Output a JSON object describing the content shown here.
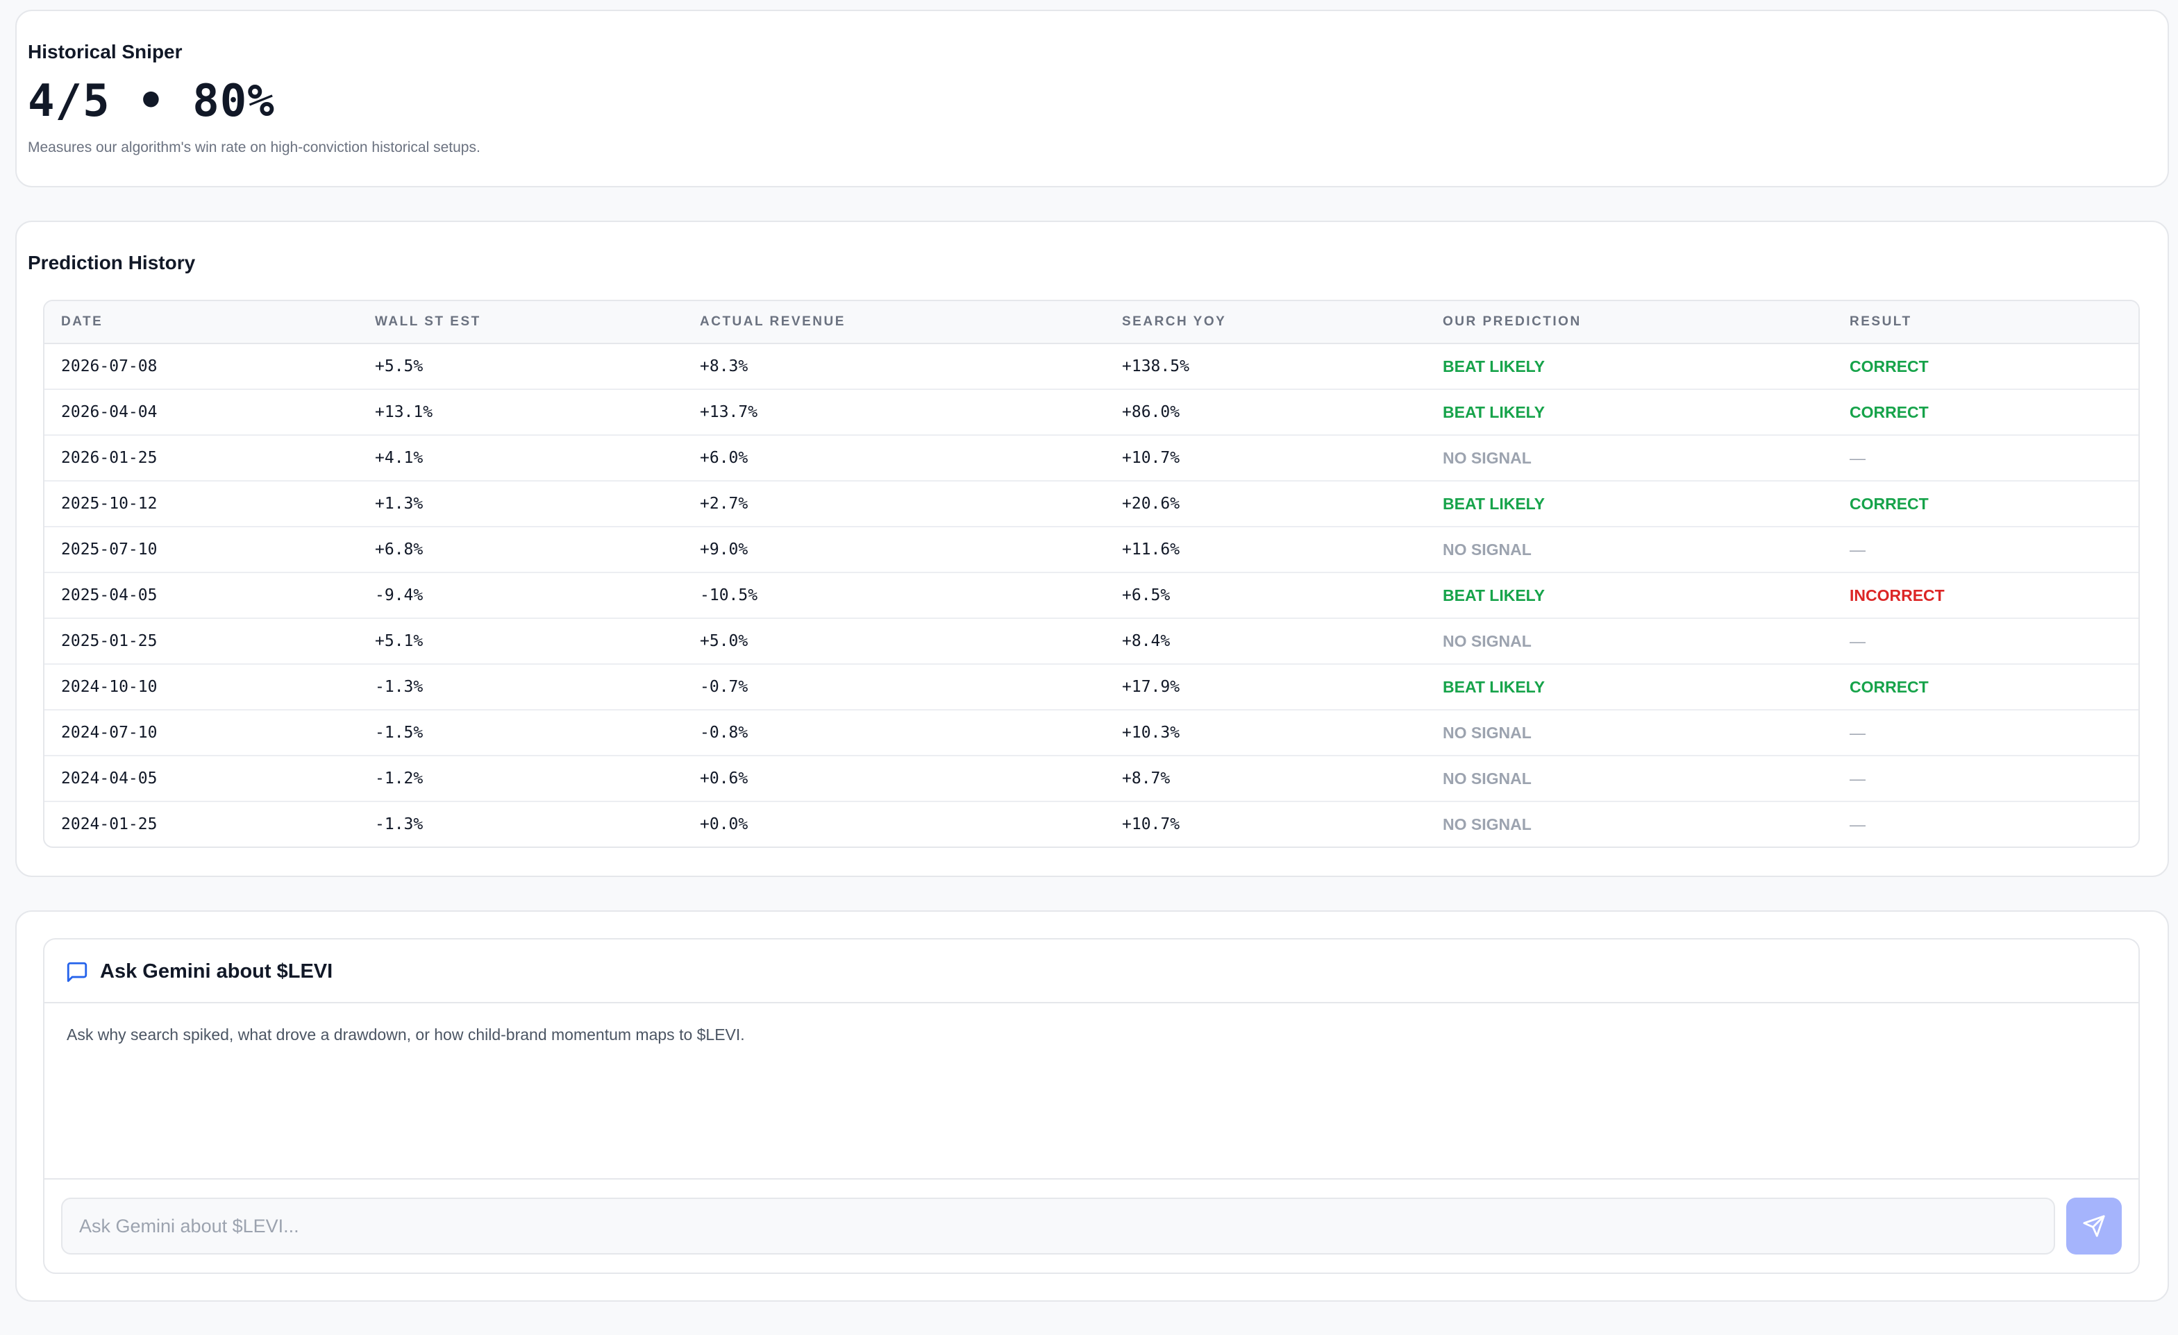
{
  "sniper": {
    "title": "Historical Sniper",
    "score": "4/5 • 80%",
    "description": "Measures our algorithm's win rate on high-conviction historical setups."
  },
  "history": {
    "title": "Prediction History",
    "columns": [
      "DATE",
      "WALL ST EST",
      "ACTUAL REVENUE",
      "SEARCH YOY",
      "OUR PREDICTION",
      "RESULT"
    ],
    "rows": [
      {
        "date": "2026-07-08",
        "wall_st_est": "+5.5%",
        "actual_revenue": "+8.3%",
        "search_yoy": "+138.5%",
        "prediction": "BEAT LIKELY",
        "result": "CORRECT"
      },
      {
        "date": "2026-04-04",
        "wall_st_est": "+13.1%",
        "actual_revenue": "+13.7%",
        "search_yoy": "+86.0%",
        "prediction": "BEAT LIKELY",
        "result": "CORRECT"
      },
      {
        "date": "2026-01-25",
        "wall_st_est": "+4.1%",
        "actual_revenue": "+6.0%",
        "search_yoy": "+10.7%",
        "prediction": "NO SIGNAL",
        "result": "—"
      },
      {
        "date": "2025-10-12",
        "wall_st_est": "+1.3%",
        "actual_revenue": "+2.7%",
        "search_yoy": "+20.6%",
        "prediction": "BEAT LIKELY",
        "result": "CORRECT"
      },
      {
        "date": "2025-07-10",
        "wall_st_est": "+6.8%",
        "actual_revenue": "+9.0%",
        "search_yoy": "+11.6%",
        "prediction": "NO SIGNAL",
        "result": "—"
      },
      {
        "date": "2025-04-05",
        "wall_st_est": "-9.4%",
        "actual_revenue": "-10.5%",
        "search_yoy": "+6.5%",
        "prediction": "BEAT LIKELY",
        "result": "INCORRECT"
      },
      {
        "date": "2025-01-25",
        "wall_st_est": "+5.1%",
        "actual_revenue": "+5.0%",
        "search_yoy": "+8.4%",
        "prediction": "NO SIGNAL",
        "result": "—"
      },
      {
        "date": "2024-10-10",
        "wall_st_est": "-1.3%",
        "actual_revenue": "-0.7%",
        "search_yoy": "+17.9%",
        "prediction": "BEAT LIKELY",
        "result": "CORRECT"
      },
      {
        "date": "2024-07-10",
        "wall_st_est": "-1.5%",
        "actual_revenue": "-0.8%",
        "search_yoy": "+10.3%",
        "prediction": "NO SIGNAL",
        "result": "—"
      },
      {
        "date": "2024-04-05",
        "wall_st_est": "-1.2%",
        "actual_revenue": "+0.6%",
        "search_yoy": "+8.7%",
        "prediction": "NO SIGNAL",
        "result": "—"
      },
      {
        "date": "2024-01-25",
        "wall_st_est": "-1.3%",
        "actual_revenue": "+0.0%",
        "search_yoy": "+10.7%",
        "prediction": "NO SIGNAL",
        "result": "—"
      }
    ]
  },
  "chat": {
    "icon": "message-square-icon",
    "title": "Ask Gemini about $LEVI",
    "hint": "Ask why search spiked, what drove a drawdown, or how child-brand momentum maps to $LEVI.",
    "input_placeholder": "Ask Gemini about $LEVI...",
    "input_value": "",
    "send_icon": "send-icon"
  },
  "colors": {
    "beat_likely": "#16a34a",
    "no_signal": "#9ca3af",
    "correct": "#16a34a",
    "incorrect": "#dc2626",
    "dash": "#9ca3af",
    "accent": "#2563eb",
    "send_button": "#a5b4fc"
  }
}
